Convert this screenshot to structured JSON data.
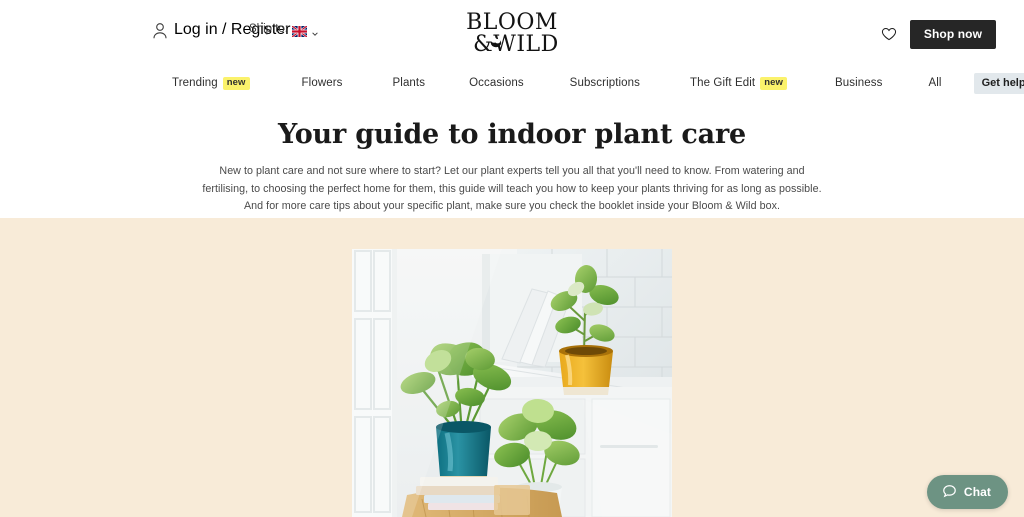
{
  "topbar": {
    "account_icon": "person-icon",
    "account_label": "Log in / Register",
    "ship_label": "Ship to:",
    "ship_country_icon": "uk-flag-icon",
    "ship_chevron_icon": "chevron-down-icon",
    "logo_line1": "BLOOM",
    "logo_line2": "& WILD",
    "logo_alt": "Bloom & Wild",
    "wishlist_icon": "heart-icon",
    "shop_now_label": "Shop now"
  },
  "nav": {
    "items": [
      {
        "label": "Trending",
        "badge": "new"
      },
      {
        "label": "Flowers",
        "badge": ""
      },
      {
        "label": "Plants",
        "badge": ""
      },
      {
        "label": "Occasions",
        "badge": ""
      },
      {
        "label": "Subscriptions",
        "badge": ""
      },
      {
        "label": "The Gift Edit",
        "badge": "new"
      },
      {
        "label": "Business",
        "badge": ""
      },
      {
        "label": "All",
        "badge": ""
      }
    ],
    "help_label": "Get help fast"
  },
  "hero": {
    "title": "Your guide to indoor plant care",
    "intro": "New to plant care and not sure where to start? Let our plant experts tell you all that you'll need to know. From watering and fertilising, to choosing the perfect home for them, this guide will teach you how to keep your plants thriving for as long as possible. And for more care tips about your specific plant, make sure you check the booklet inside your Bloom & Wild box.",
    "image_alt": "Indoor houseplants on a kitchen counter beside a window",
    "band_color": "#F8EBD8"
  },
  "chat": {
    "icon": "speech-bubble-icon",
    "label": "Chat",
    "color": "#6D9383"
  }
}
